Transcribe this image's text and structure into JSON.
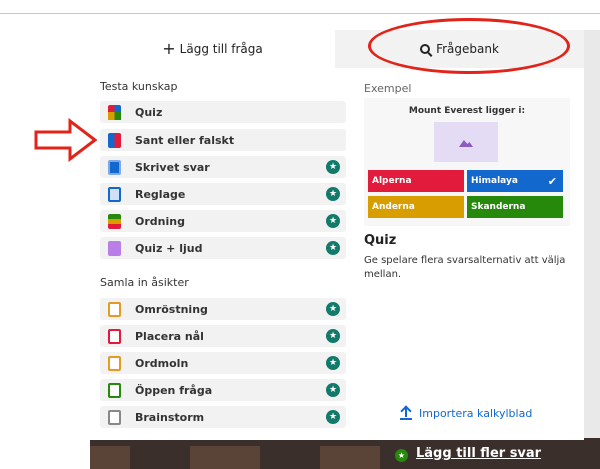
{
  "tabs": {
    "add_question": "Lägg till fråga",
    "question_bank": "Frågebank"
  },
  "sections": {
    "test_knowledge": "Testa kunskap",
    "collect_opinions": "Samla in åsikter"
  },
  "knowledge_items": [
    {
      "label": "Quiz",
      "icon": "quiz-icon",
      "premium": false
    },
    {
      "label": "Sant eller falskt",
      "icon": "true-false-icon",
      "premium": false
    },
    {
      "label": "Skrivet svar",
      "icon": "typed-answer-icon",
      "premium": true
    },
    {
      "label": "Reglage",
      "icon": "slider-icon",
      "premium": true
    },
    {
      "label": "Ordning",
      "icon": "ordering-icon",
      "premium": true
    },
    {
      "label": "Quiz + ljud",
      "icon": "audio-quiz-icon",
      "premium": true
    }
  ],
  "opinion_items": [
    {
      "label": "Omröstning",
      "icon": "poll-icon",
      "premium": true
    },
    {
      "label": "Placera nål",
      "icon": "pin-icon",
      "premium": true
    },
    {
      "label": "Ordmoln",
      "icon": "word-cloud-icon",
      "premium": true
    },
    {
      "label": "Öppen fråga",
      "icon": "open-question-icon",
      "premium": true
    },
    {
      "label": "Brainstorm",
      "icon": "brainstorm-icon",
      "premium": true
    }
  ],
  "example": {
    "label": "Exempel",
    "question": "Mount Everest ligger i:",
    "answers": [
      {
        "text": "Alperna",
        "color": "#e21b3c",
        "correct": false
      },
      {
        "text": "Himalaya",
        "color": "#1368ce",
        "correct": true
      },
      {
        "text": "Anderna",
        "color": "#d89e00",
        "correct": false
      },
      {
        "text": "Skanderna",
        "color": "#26890c",
        "correct": false
      }
    ],
    "title": "Quiz",
    "description": "Ge spelare flera svarsalternativ att välja mellan."
  },
  "import_label": "Importera kalkylblad",
  "more_button": "Lägg till fler svar",
  "colors": {
    "premium_star": "#127a6a",
    "accent_blue": "#1368ce",
    "annotation_red": "#e2231a"
  }
}
